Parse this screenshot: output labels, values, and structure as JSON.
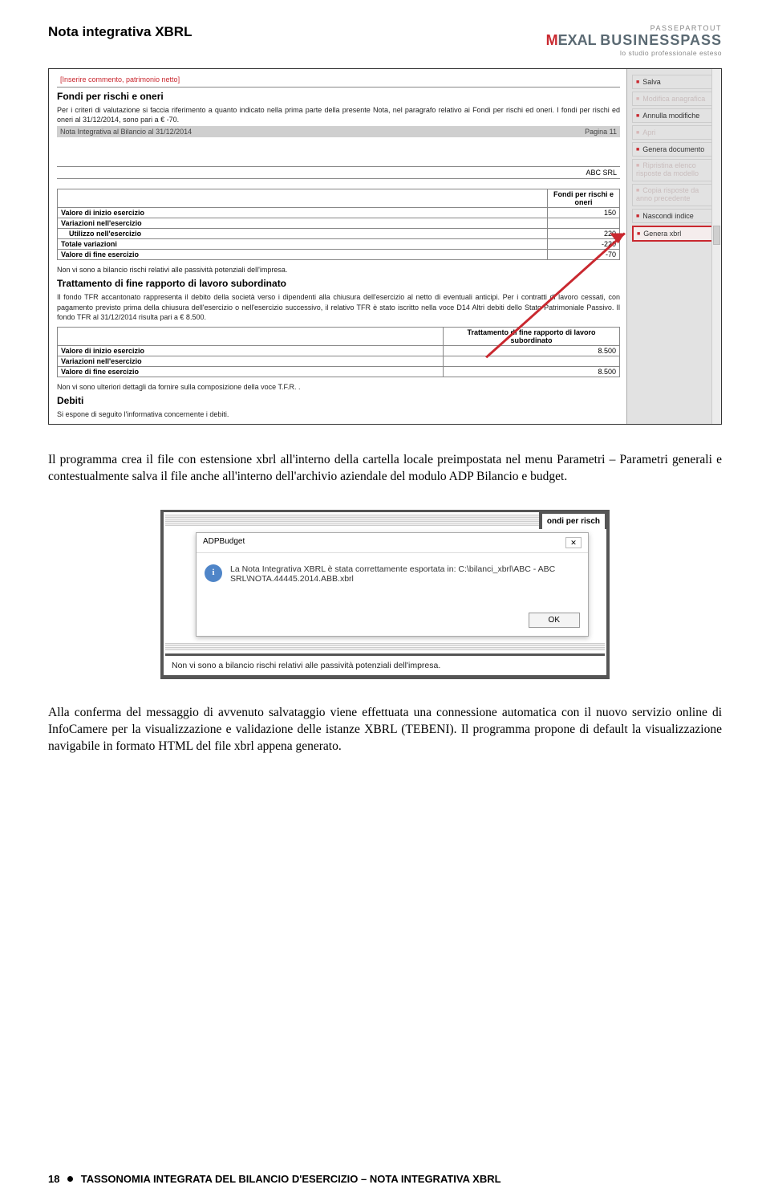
{
  "header": {
    "doc_title": "Nota integrativa XBRL",
    "brand_tag": "PASSEPARTOUT",
    "brand1a": "M",
    "brand1b": "EXAL",
    "brand2": "BUSINESSPASS",
    "brand_sub": "lo studio professionale esteso"
  },
  "screenshot1": {
    "placeholder": "[Inserire commento, patrimonio netto]",
    "section1_title": "Fondi per rischi e oneri",
    "section1_body": "Per i criteri di valutazione si faccia riferimento a quanto indicato nella prima parte della presente Nota, nel paragrafo relativo ai Fondi per rischi ed oneri. I fondi per rischi ed oneri al 31/12/2014, sono pari a € -70.",
    "footer_left": "Nota Integrativa al Bilancio al 31/12/2014",
    "footer_right": "Pagina 11",
    "company": "ABC SRL",
    "table1_header": "Fondi per rischi e oneri",
    "table1": [
      {
        "label": "Valore di inizio esercizio",
        "value": "150"
      },
      {
        "label": "Variazioni nell'esercizio",
        "value": ""
      },
      {
        "label": "Utilizzo nell'esercizio",
        "value": "220",
        "indent": true
      },
      {
        "label": "Totale variazioni",
        "value": "-220"
      },
      {
        "label": "Valore di fine esercizio",
        "value": "-70"
      }
    ],
    "note1": "Non vi sono a bilancio rischi relativi alle passività potenziali dell'impresa.",
    "section2_title": "Trattamento di fine rapporto di lavoro subordinato",
    "section2_body": "Il fondo TFR accantonato rappresenta il debito della società verso i dipendenti alla chiusura dell'esercizio al netto di eventuali anticipi. Per i contratti di lavoro cessati, con pagamento previsto prima della chiusura dell'esercizio o nell'esercizio successivo, il relativo TFR è stato iscritto nella voce D14 Altri debiti dello Stato Patrimoniale Passivo. Il fondo TFR al 31/12/2014 risulta pari a € 8.500.",
    "table2_header": "Trattamento di fine rapporto di lavoro subordinato",
    "table2": [
      {
        "label": "Valore di inizio esercizio",
        "value": "8.500"
      },
      {
        "label": "Variazioni nell'esercizio",
        "value": ""
      },
      {
        "label": "Valore di fine esercizio",
        "value": "8.500"
      }
    ],
    "note2": "Non vi sono ulteriori dettagli da fornire sulla composizione della voce T.F.R. .",
    "section3_title": "Debiti",
    "section3_body": "Si espone di seguito l'informativa concernente i debiti.",
    "sidebar": {
      "salva": "Salva",
      "mod": "Modifica anagrafica",
      "annulla": "Annulla modifiche",
      "apri": "Apri",
      "genera_doc": "Genera documento",
      "ripristina": "Ripristina elenco risposte da modello",
      "copia": "Copia risposte da anno precedente",
      "nascondi": "Nascondi indice",
      "genera_xbrl": "Genera xbrl"
    }
  },
  "para1": "Il programma crea il file con estensione xbrl all'interno della cartella locale preimpostata nel menu Parametri – Parametri generali e contestualmente salva il file anche all'interno dell'archivio aziendale del modulo ADP Bilancio e budget.",
  "screenshot2": {
    "tab_right": "ondi per risch",
    "dlg_title": "ADPBudget",
    "dlg_x": "✕",
    "dlg_msg": "La Nota Integrativa XBRL è stata correttamente esportata in: C:\\bilanci_xbrl\\ABC - ABC SRL\\NOTA.44445.2014.ABB.xbrl",
    "dlg_ok": "OK",
    "bottom_text": "Non vi sono a bilancio rischi relativi alle passività potenziali dell'impresa."
  },
  "para2": "Alla conferma del messaggio di avvenuto salvataggio viene effettuata una connessione automatica con il nuovo servizio online di InfoCamere per la visualizzazione e validazione delle istanze XBRL (TEBENI). Il programma propone di default la visualizzazione navigabile in formato HTML del file xbrl appena generato.",
  "footer": {
    "page": "18",
    "text": "TASSONOMIA INTEGRATA DEL BILANCIO D'ESERCIZIO – NOTA INTEGRATIVA XBRL"
  }
}
